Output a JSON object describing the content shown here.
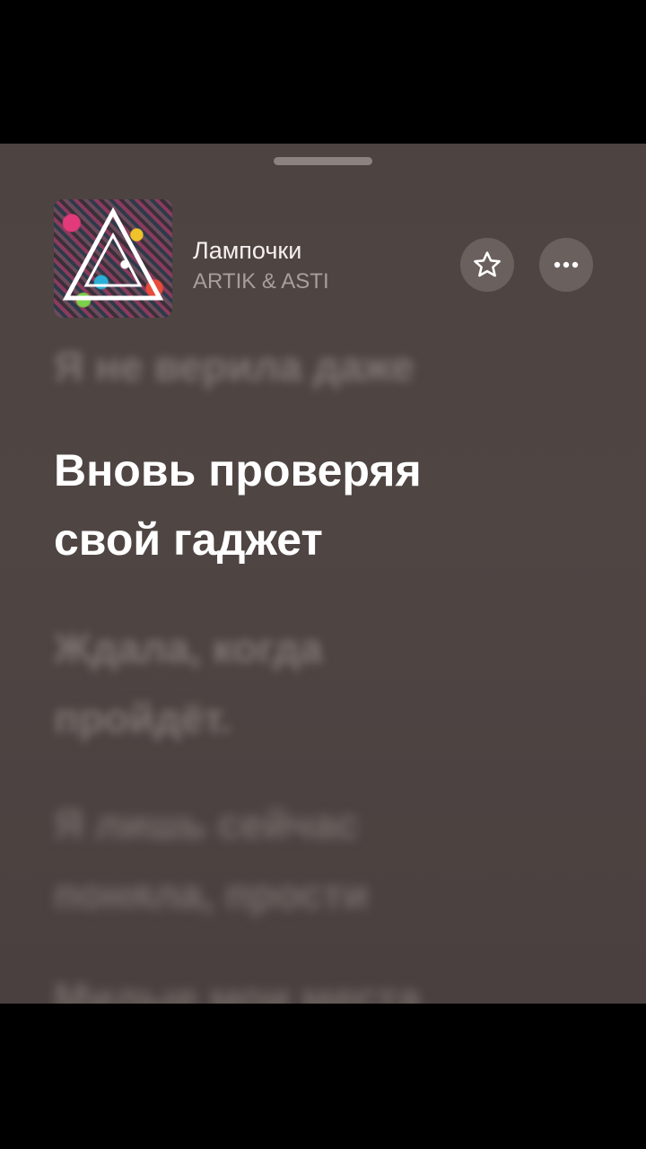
{
  "track": {
    "title": "Лампочки",
    "artist": "ARTIK & ASTI",
    "cover_icon": "album-cover-art"
  },
  "actions": {
    "favorite_icon": "star-outline-icon",
    "more_icon": "ellipsis-icon"
  },
  "lyrics": {
    "previous": "Я не верила даже",
    "current_line1": "Вновь проверяя",
    "current_line2": "свой гаджет",
    "next1_line1": "Ждала, когда",
    "next1_line2": "пройдёт.",
    "next2_line1": "Я лишь сейчас",
    "next2_line2": "поняла, прости",
    "next3": "Милые мои места"
  },
  "colors": {
    "background": "#4d4341",
    "active_lyric": "#ffffff",
    "inactive_lyric": "#7f7573",
    "button_bg": "#6a605e"
  }
}
